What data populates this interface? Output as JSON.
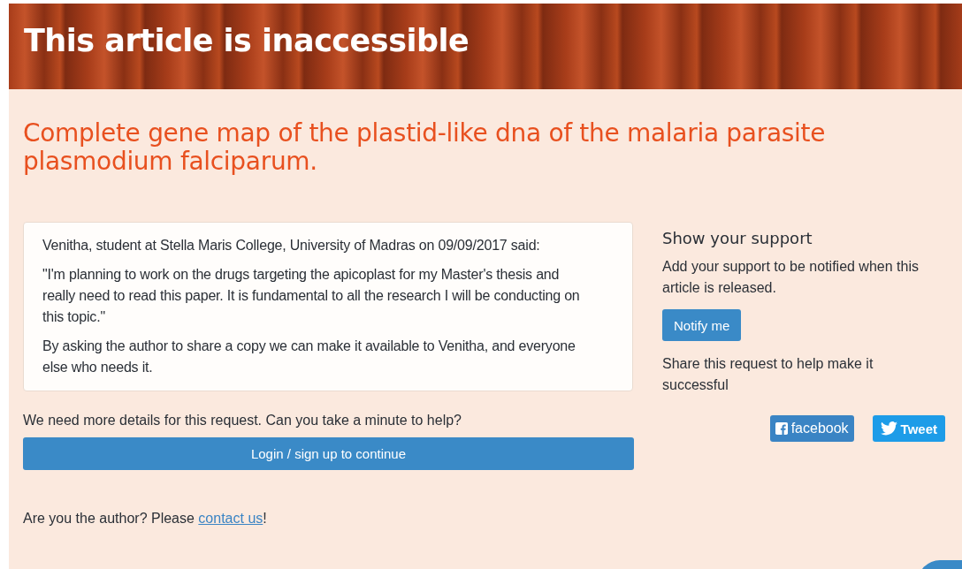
{
  "banner": {
    "title": "This article is inaccessible"
  },
  "article_title": "Complete gene map of the plastid-like dna of the malaria parasite plasmodium falciparum.",
  "request_card": {
    "byline": "Venitha, student at Stella Maris College, University of Madras on 09/09/2017 said:",
    "quote": "\"I'm planning to work on the drugs targeting the apicoplast for my Master's thesis and really need to read this paper. It is fundamental to all the research I will be conducting on this topic.\"",
    "note": "By asking the author to share a copy we can make it available to Venitha, and everyone else who needs it."
  },
  "help_prompt": "We need more details for this request. Can you take a minute to help?",
  "login_button": "Login / sign up to continue",
  "author_prompt": {
    "text": "Are you the author? Please ",
    "link": "contact us",
    "after": "!"
  },
  "support": {
    "heading": "Show your support",
    "text": "Add your support to be notified when this article is released.",
    "button": "Notify me",
    "share_text": "Share this request to help make it successful",
    "share_buttons": [
      {
        "kind": "facebook",
        "label": "facebook"
      },
      {
        "kind": "twitter",
        "label": "Tweet"
      }
    ]
  }
}
